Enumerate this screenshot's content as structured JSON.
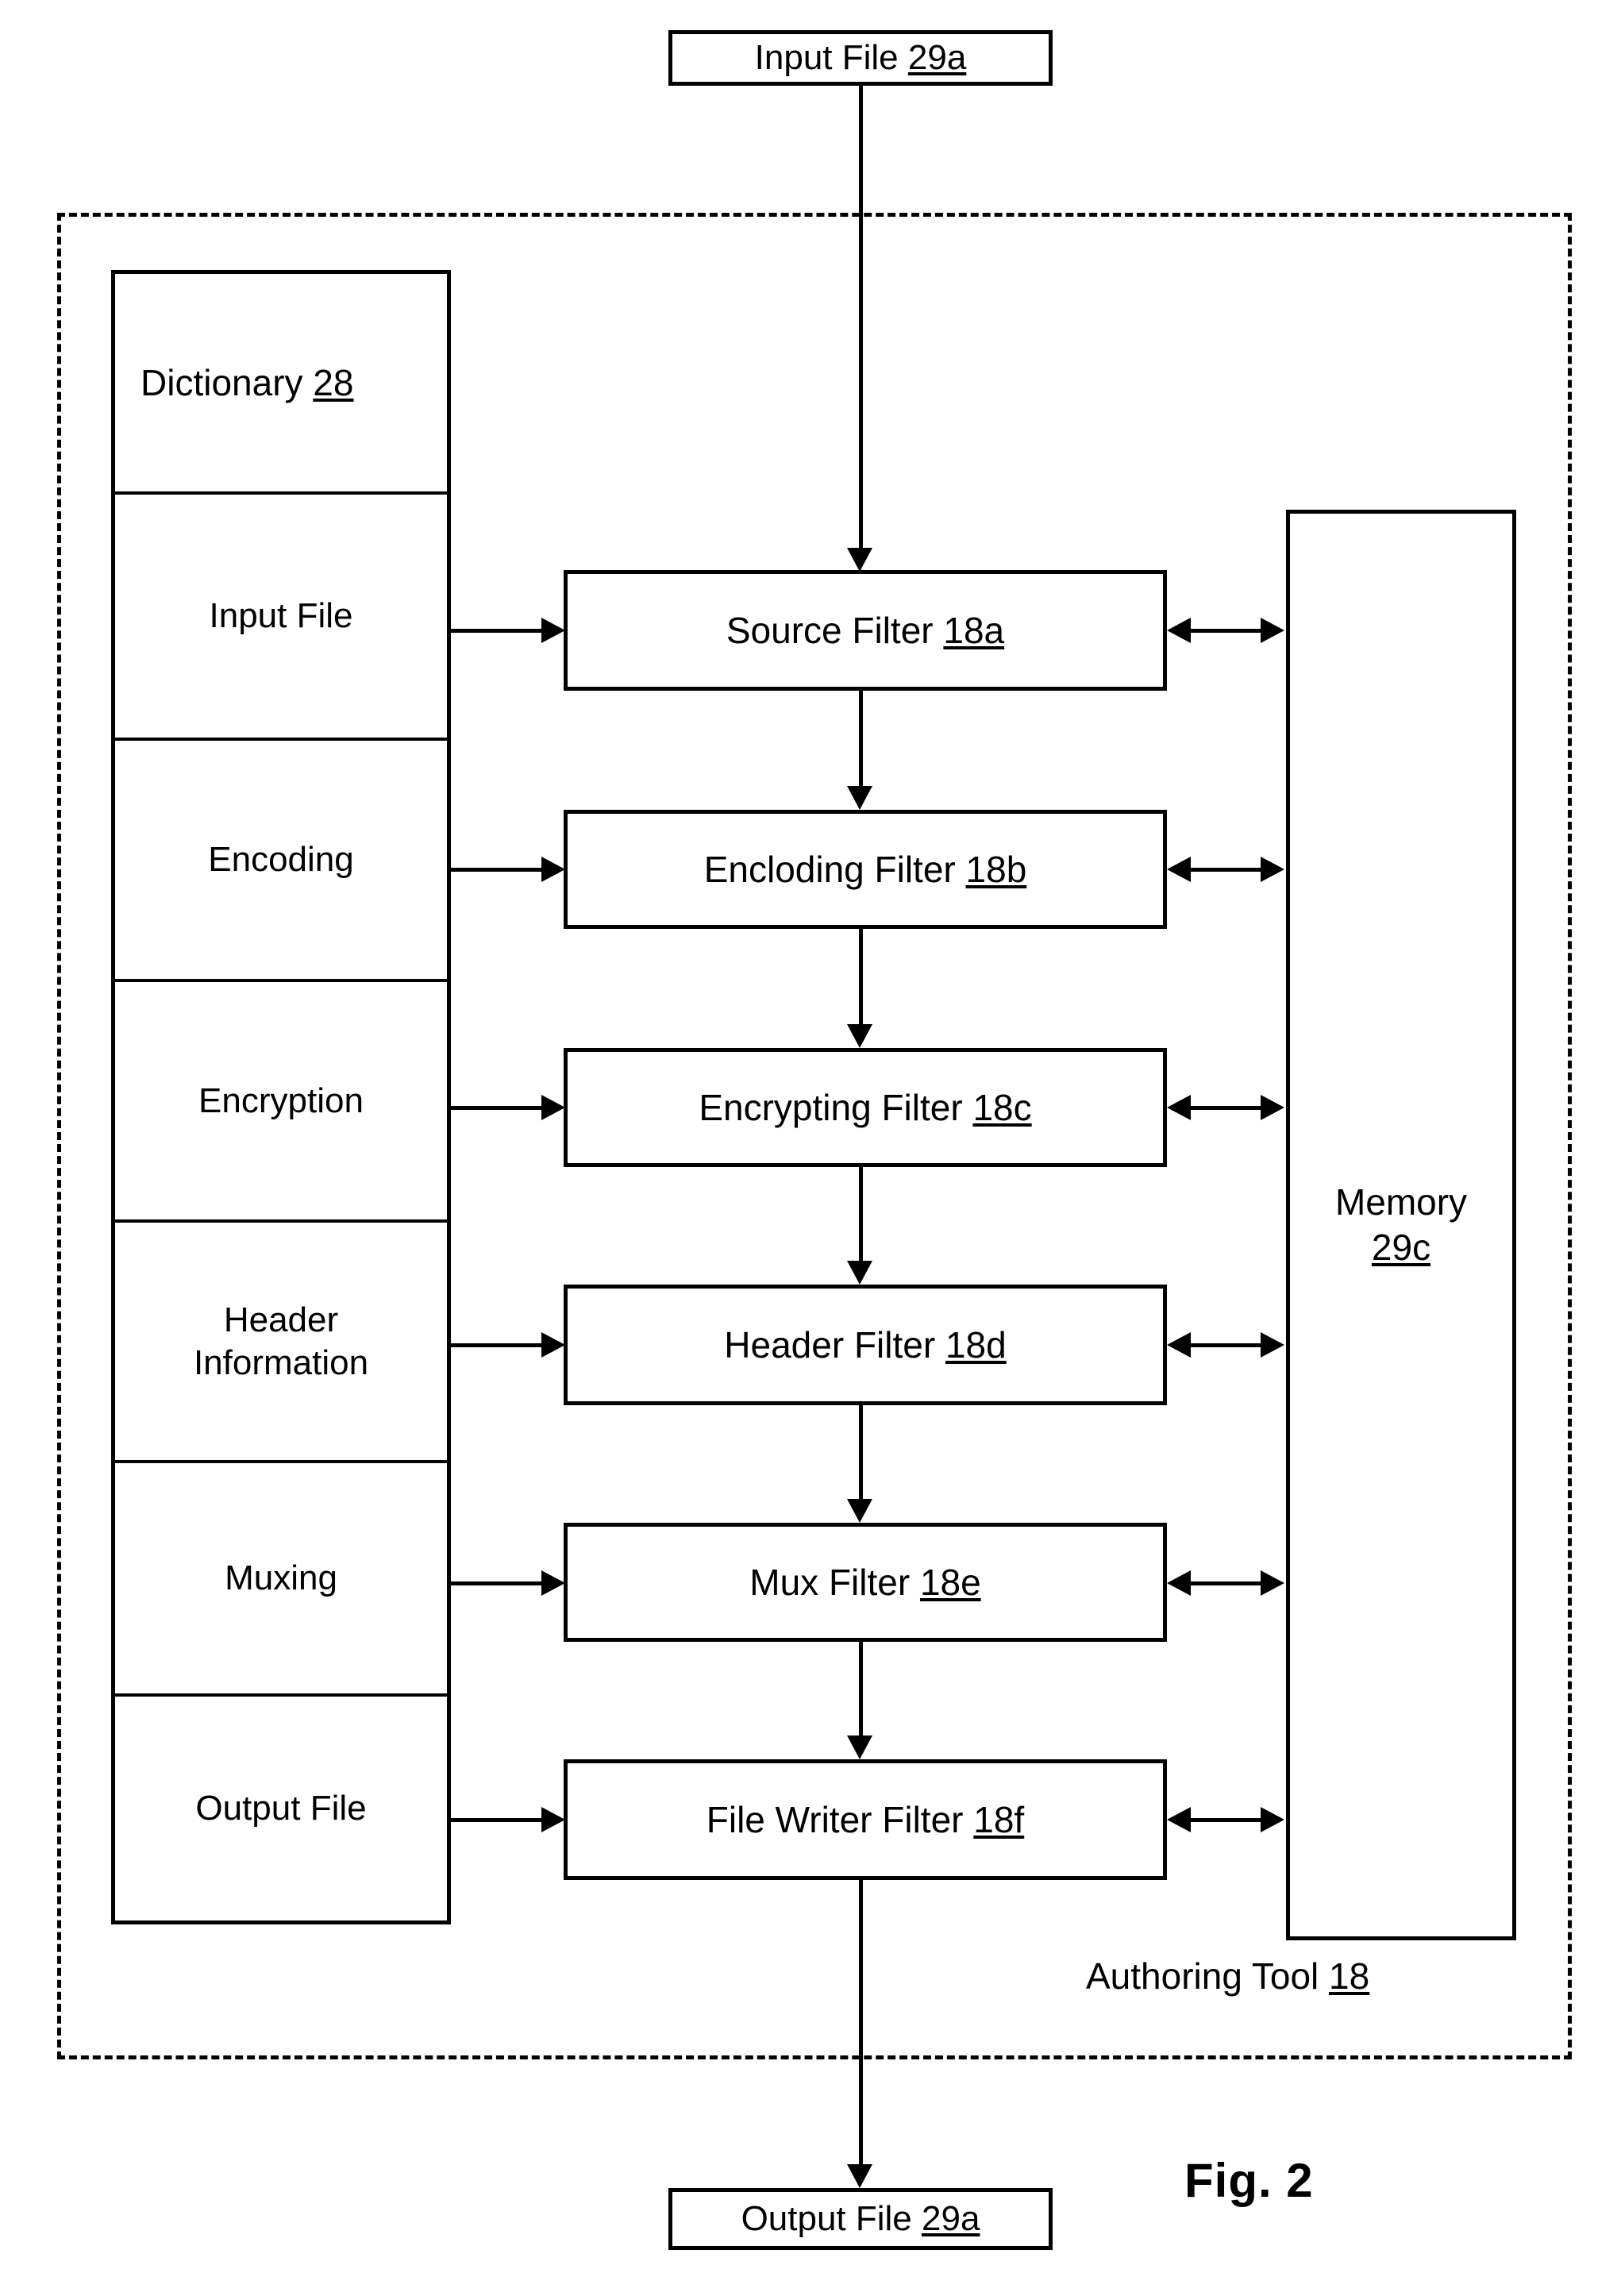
{
  "figure": {
    "caption": "Fig. 2"
  },
  "io": {
    "input_label": "Input File ",
    "input_ref": "29a",
    "output_label": "Output File ",
    "output_ref": "29a"
  },
  "authoring_tool": {
    "label": "Authoring Tool ",
    "ref": "18"
  },
  "dictionary": {
    "title": "Dictionary ",
    "ref": "28",
    "rows": [
      {
        "label": "Input File"
      },
      {
        "label": "Encoding"
      },
      {
        "label": "Encryption"
      },
      {
        "label": "Header\nInformation"
      },
      {
        "label": "Muxing"
      },
      {
        "label": "Output File"
      }
    ]
  },
  "filters": [
    {
      "label": "Source Filter ",
      "ref": "18a"
    },
    {
      "label": "Encloding Filter ",
      "ref": "18b"
    },
    {
      "label": "Encrypting Filter ",
      "ref": "18c"
    },
    {
      "label": "Header Filter ",
      "ref": "18d"
    },
    {
      "label": "Mux Filter ",
      "ref": "18e"
    },
    {
      "label": "File Writer Filter ",
      "ref": "18f"
    }
  ],
  "memory": {
    "label": "Memory",
    "ref": "29c"
  },
  "colors": {
    "stroke": "#000000",
    "background": "#ffffff"
  }
}
